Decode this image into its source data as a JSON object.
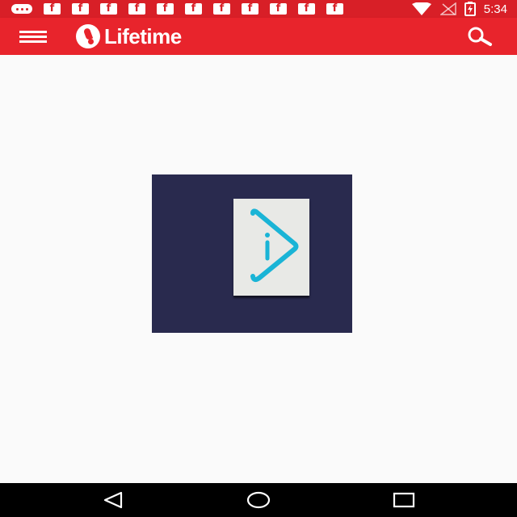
{
  "status_bar": {
    "time": "5:34",
    "notifications": [
      "chat-icon",
      "facebook-icon",
      "facebook-icon",
      "facebook-icon",
      "facebook-icon",
      "facebook-icon",
      "facebook-icon",
      "facebook-icon",
      "facebook-icon",
      "facebook-icon",
      "facebook-icon",
      "facebook-icon"
    ],
    "facebook_glyph": "f",
    "system_icons": [
      "wifi-icon",
      "no-signal-icon",
      "battery-charging-icon"
    ]
  },
  "app_bar": {
    "brand": "Lifetime",
    "menu_icon": "hamburger-menu-icon",
    "search_icon": "search-icon",
    "color": "#e8242c"
  },
  "content": {
    "thumbnail_icon": "play-logo-icon",
    "thumbnail_bg": "#292a4e",
    "logo_color": "#1ab4d6"
  },
  "nav_bar": {
    "buttons": [
      "back-icon",
      "home-icon",
      "recents-icon"
    ]
  }
}
